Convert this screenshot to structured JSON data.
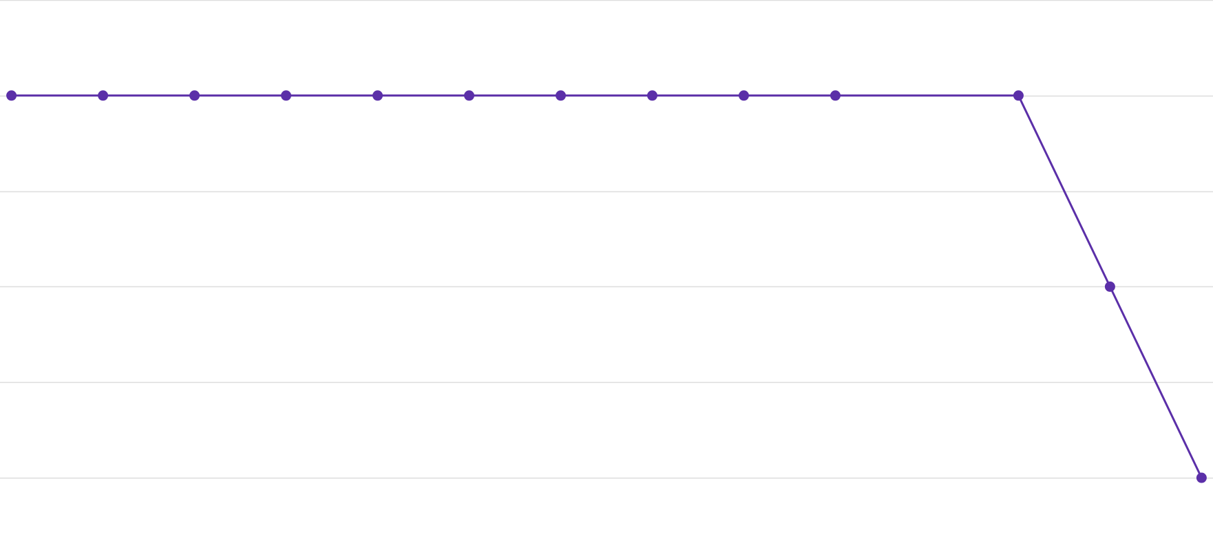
{
  "chart_data": {
    "type": "line",
    "title": "",
    "xlabel": "",
    "ylabel": "",
    "x": [
      1,
      2,
      3,
      4,
      5,
      6,
      7,
      8,
      9,
      10,
      12,
      13,
      14
    ],
    "series": [
      {
        "values": [
          4,
          4,
          4,
          4,
          4,
          4,
          4,
          4,
          4,
          4,
          4,
          2,
          0
        ]
      }
    ],
    "xlim": [
      0.875,
      14.125
    ],
    "ylim": [
      -0.85,
      5
    ],
    "gridlines_y": [
      0,
      1,
      2,
      3,
      4,
      5
    ],
    "grid": true,
    "legend": "none",
    "colors": {
      "line": "#5b2fa8",
      "grid": "#dddddd",
      "background": "#ffffff"
    }
  }
}
